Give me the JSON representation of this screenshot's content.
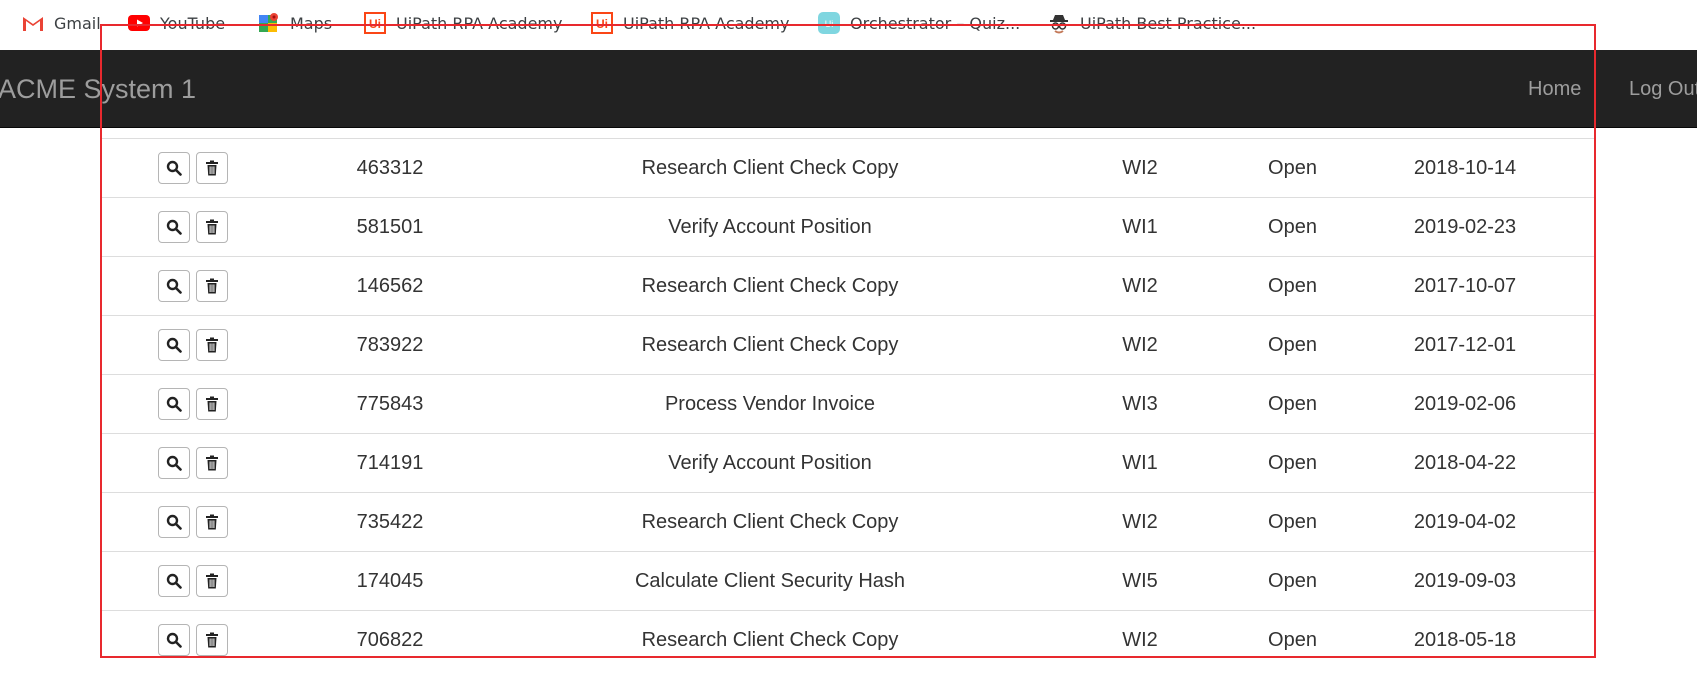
{
  "bookmarks": [
    {
      "label": "Gmail",
      "icon": "gmail-icon"
    },
    {
      "label": "YouTube",
      "icon": "youtube-icon"
    },
    {
      "label": "Maps",
      "icon": "maps-icon"
    },
    {
      "label": "UiPath RPA Academy",
      "icon": "uipath-icon"
    },
    {
      "label": "UiPath RPA Academy",
      "icon": "uipath-icon"
    },
    {
      "label": "Orchestrator – Quiz...",
      "icon": "orchestrator-icon"
    },
    {
      "label": "UiPath Best Practice...",
      "icon": "spy-icon"
    }
  ],
  "navbar": {
    "brand": "ACME System 1",
    "home": "Home",
    "logout": "Log Out"
  },
  "table": {
    "rows": [
      {
        "id": "463312",
        "description": "Research Client Check Copy",
        "type": "WI2",
        "status": "Open",
        "date": "2018-10-14"
      },
      {
        "id": "581501",
        "description": "Verify Account Position",
        "type": "WI1",
        "status": "Open",
        "date": "2019-02-23"
      },
      {
        "id": "146562",
        "description": "Research Client Check Copy",
        "type": "WI2",
        "status": "Open",
        "date": "2017-10-07"
      },
      {
        "id": "783922",
        "description": "Research Client Check Copy",
        "type": "WI2",
        "status": "Open",
        "date": "2017-12-01"
      },
      {
        "id": "775843",
        "description": "Process Vendor Invoice",
        "type": "WI3",
        "status": "Open",
        "date": "2019-02-06"
      },
      {
        "id": "714191",
        "description": "Verify Account Position",
        "type": "WI1",
        "status": "Open",
        "date": "2018-04-22"
      },
      {
        "id": "735422",
        "description": "Research Client Check Copy",
        "type": "WI2",
        "status": "Open",
        "date": "2019-04-02"
      },
      {
        "id": "174045",
        "description": "Calculate Client Security Hash",
        "type": "WI5",
        "status": "Open",
        "date": "2019-09-03"
      },
      {
        "id": "706822",
        "description": "Research Client Check Copy",
        "type": "WI2",
        "status": "Open",
        "date": "2018-05-18"
      }
    ]
  },
  "colors": {
    "navbar_bg": "#222222",
    "navbar_text": "#9d9d9d",
    "annotation_frame": "#e8292e",
    "row_divider": "#dddddd"
  }
}
